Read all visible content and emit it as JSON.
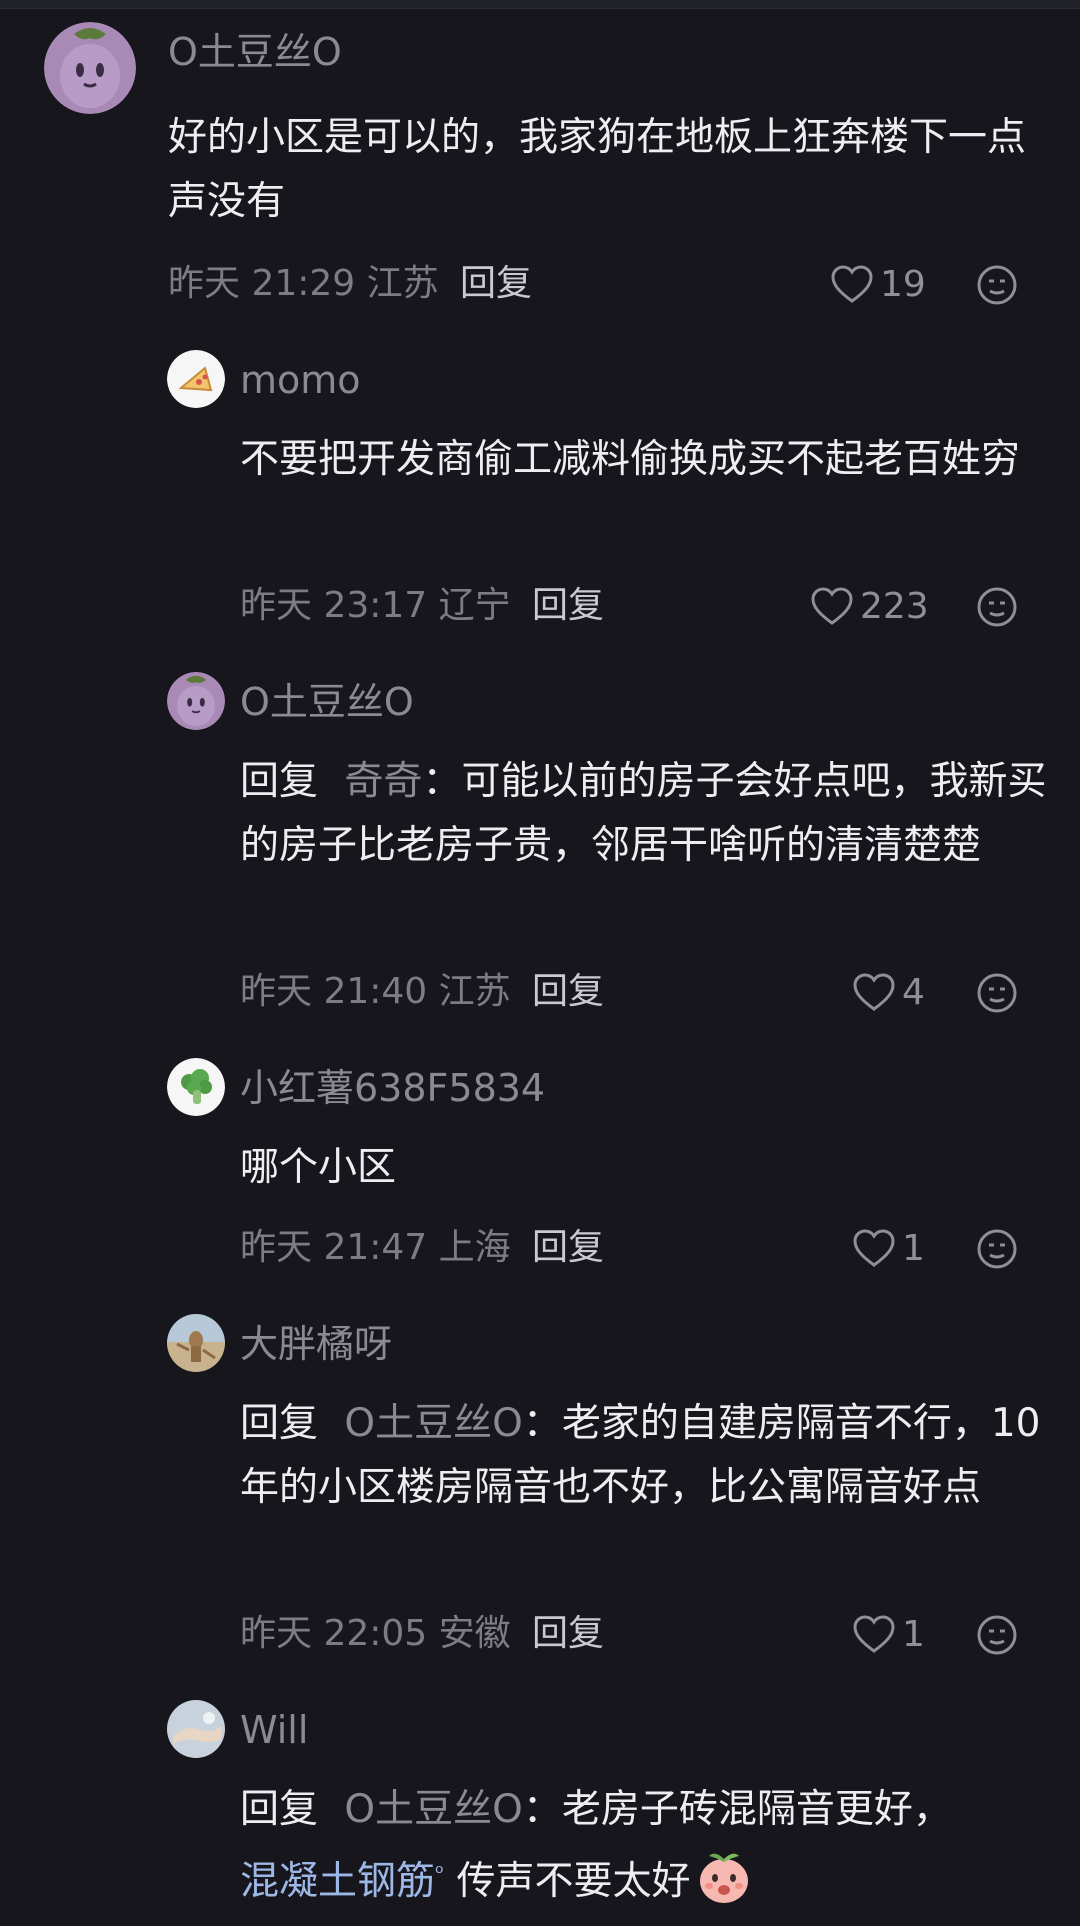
{
  "comments": [
    {
      "user": "O土豆丝O",
      "avatar_icon": "eggplant-avatar",
      "text": "好的小区是可以的，我家狗在地板上狂奔楼下一点声没有",
      "meta": "昨天 21:29 江苏",
      "reply_label": "回复",
      "likes": "19"
    },
    {
      "user": "momo",
      "avatar_icon": "pizza-avatar",
      "text": "不要把开发商偷工减料偷换成买不起老百姓穷",
      "meta": "昨天 23:17 辽宁",
      "reply_label": "回复",
      "likes": "223"
    },
    {
      "user": "O土豆丝O",
      "avatar_icon": "eggplant-avatar",
      "reply_prefix": "回复",
      "mention": "奇奇",
      "text": "：可能以前的房子会好点吧，我新买的房子比老房子贵，邻居干啥听的清清楚楚",
      "meta": "昨天 21:40 江苏",
      "reply_label": "回复",
      "likes": "4"
    },
    {
      "user": "小红薯638F5834",
      "avatar_icon": "broccoli-avatar",
      "text": "哪个小区",
      "meta": "昨天 21:47 上海",
      "reply_label": "回复",
      "likes": "1"
    },
    {
      "user": "大胖橘呀",
      "avatar_icon": "beach-photo-avatar",
      "reply_prefix": "回复",
      "mention": "O土豆丝O",
      "text": "：老家的自建房隔音不行，10年的小区楼房隔音也不好，比公寓隔音好点",
      "meta": "昨天 22:05 安徽",
      "reply_label": "回复",
      "likes": "1"
    },
    {
      "user": "Wi‍ll",
      "avatar_icon": "sky-photo-avatar",
      "reply_prefix": "回复",
      "mention": "O土豆丝O",
      "text_a": "：老房子砖混隔音更好，",
      "link": "混凝土钢筋",
      "text_b": "传声不要太好",
      "trailing_emoji": "peach-face-emoji"
    }
  ],
  "colors": {
    "background": "#17161d",
    "username": "#8a8a94",
    "body_text": "#eeeef2",
    "link": "#9db8e6"
  }
}
